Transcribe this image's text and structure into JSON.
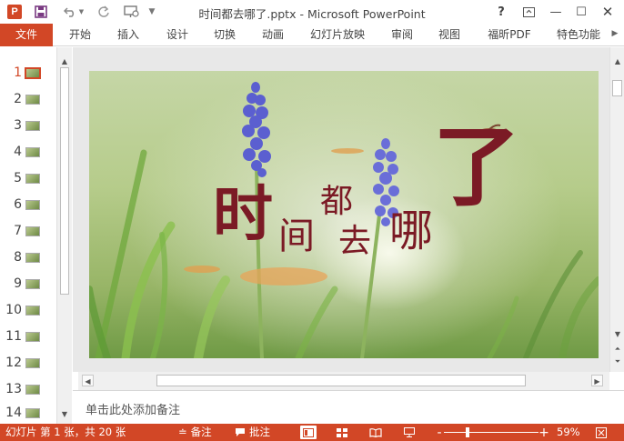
{
  "window": {
    "title": "时间都去哪了.pptx - Microsoft PowerPoint",
    "app_icon_letter": "P",
    "help": "?",
    "minimize": "—",
    "maximize": "☐",
    "close": "✕"
  },
  "ribbon": {
    "tabs": [
      "文件",
      "开始",
      "插入",
      "设计",
      "切换",
      "动画",
      "幻灯片放映",
      "审阅",
      "视图",
      "福昕PDF",
      "特色功能"
    ]
  },
  "thumbnails": {
    "numbers": [
      "1",
      "2",
      "3",
      "4",
      "5",
      "6",
      "7",
      "8",
      "9",
      "10",
      "11",
      "12",
      "13",
      "14"
    ],
    "active_index": 0
  },
  "slide": {
    "title_chars": {
      "shi": "时",
      "jian": "间",
      "dou": "都",
      "qu": "去",
      "na": "哪",
      "le": "了"
    },
    "text_color": "#7b1a25"
  },
  "notes": {
    "placeholder": "单击此处添加备注"
  },
  "status": {
    "slide_count": "幻灯片 第 1 张，共 20 张",
    "notes_label": "备注",
    "comments_label": "批注",
    "zoom_percent": "59%",
    "zoom_minus": "-",
    "zoom_plus": "+"
  },
  "colors": {
    "accent": "#d24726",
    "status_bar": "#d24726"
  }
}
